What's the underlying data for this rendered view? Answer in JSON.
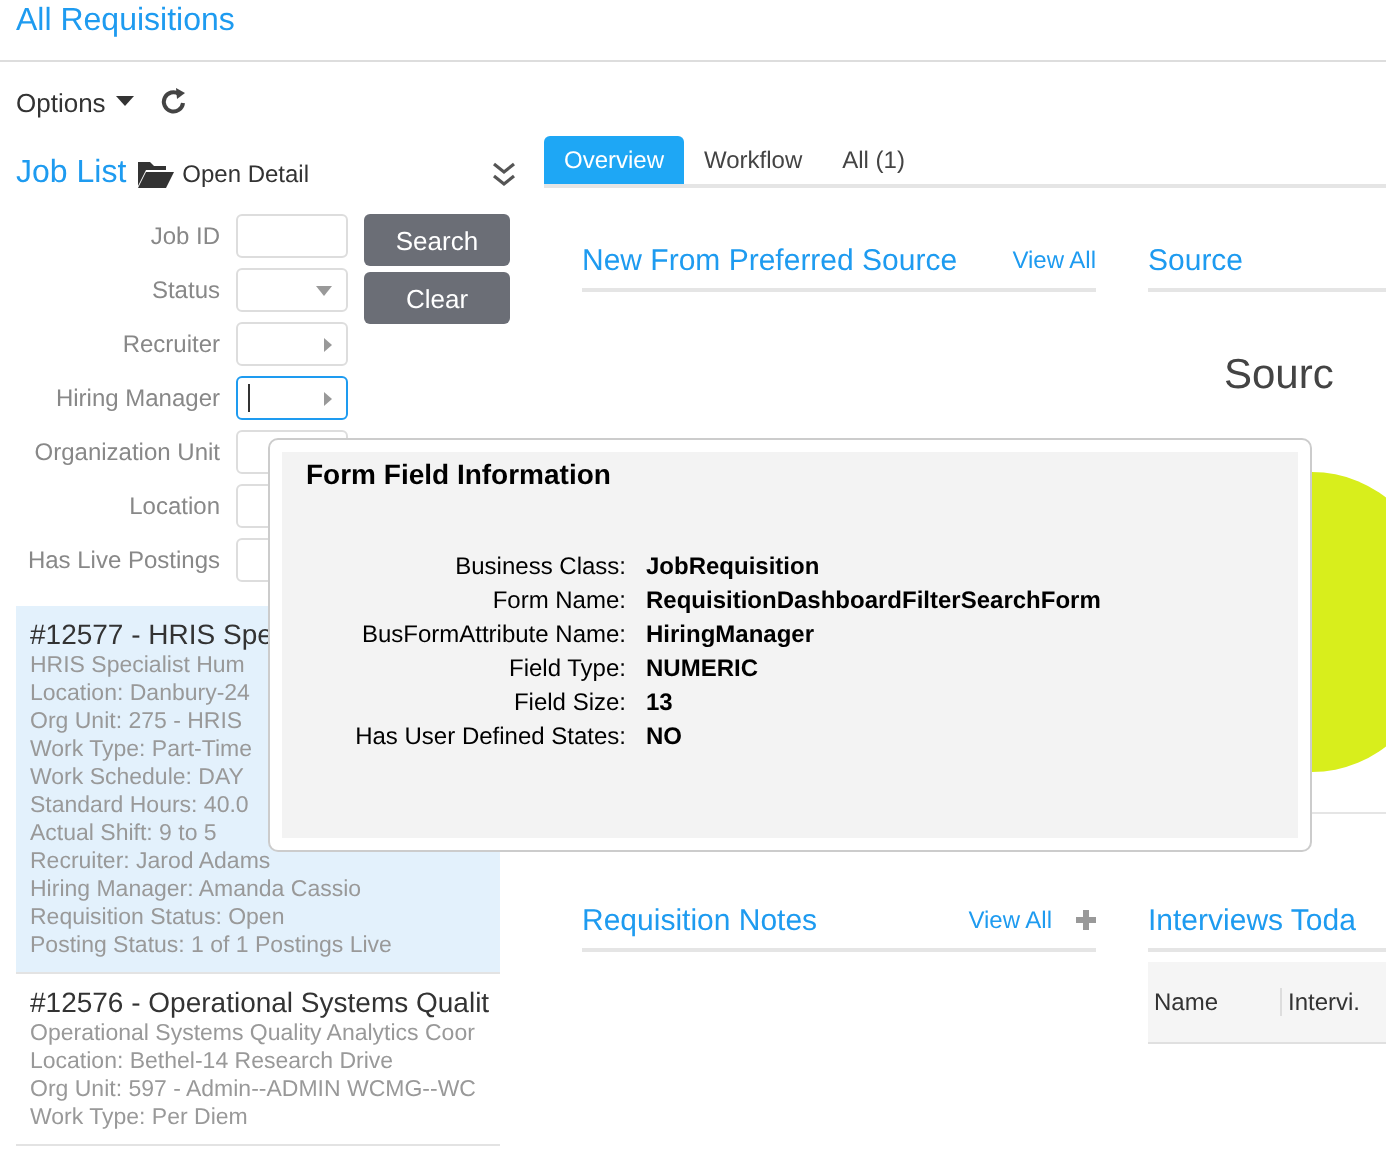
{
  "page_title": "All Requisitions",
  "toolbar": {
    "options_label": "Options"
  },
  "job_list": {
    "title": "Job List",
    "open_detail": "Open Detail",
    "filters": [
      {
        "label": "Job ID",
        "kind": "text",
        "focused": false
      },
      {
        "label": "Status",
        "kind": "dropdown",
        "focused": false
      },
      {
        "label": "Recruiter",
        "kind": "lookup",
        "focused": false
      },
      {
        "label": "Hiring Manager",
        "kind": "lookup",
        "focused": true
      },
      {
        "label": "Organization Unit",
        "kind": "text",
        "focused": false
      },
      {
        "label": "Location",
        "kind": "text",
        "focused": false
      },
      {
        "label": "Has Live Postings",
        "kind": "text",
        "focused": false
      }
    ],
    "buttons": [
      {
        "label": "Search"
      },
      {
        "label": "Clear"
      }
    ],
    "jobs": [
      {
        "title": "#12577 - HRIS Spe",
        "selected": true,
        "lines": [
          "HRIS Specialist  Hum",
          "Location: Danbury-24",
          "Org Unit: 275 - HRIS",
          "Work Type: Part-Time",
          "Work Schedule: DAY",
          "Standard Hours: 40.0",
          "Actual Shift: 9 to 5",
          "Recruiter: Jarod Adams",
          "Hiring Manager: Amanda Cassio",
          "Requisition Status: Open",
          "Posting Status: 1 of 1 Postings Live"
        ]
      },
      {
        "title": "#12576 - Operational Systems Qualit",
        "selected": false,
        "lines": [
          "Operational Systems Quality Analytics Coor",
          "Location: Bethel-14 Research Drive",
          "Org Unit: 597 - Admin--ADMIN WCMG--WC",
          "Work Type: Per Diem"
        ]
      }
    ]
  },
  "tabs": [
    {
      "label": "Overview",
      "selected": true
    },
    {
      "label": "Workflow",
      "selected": false
    },
    {
      "label": "All (1)",
      "selected": false
    }
  ],
  "panels": {
    "preferred": {
      "title": "New From Preferred Source",
      "link": "View All"
    },
    "source": {
      "title": "Source",
      "chart_title": "Sourc"
    },
    "notes": {
      "title": "Requisition Notes",
      "link": "View All"
    },
    "interviews": {
      "title": "Interviews Toda",
      "columns": [
        "Name",
        "Intervi."
      ]
    }
  },
  "tooltip": {
    "title": "Form Field Information",
    "rows": [
      {
        "label": "Business Class:",
        "value": "JobRequisition"
      },
      {
        "label": "Form Name:",
        "value": "RequisitionDashboardFilterSearchForm"
      },
      {
        "label": "BusFormAttribute Name:",
        "value": "HiringManager"
      },
      {
        "label": "Field Type:",
        "value": "NUMERIC"
      },
      {
        "label": "Field Size:",
        "value": "13"
      },
      {
        "label": "Has User Defined States:",
        "value": "NO"
      }
    ]
  }
}
